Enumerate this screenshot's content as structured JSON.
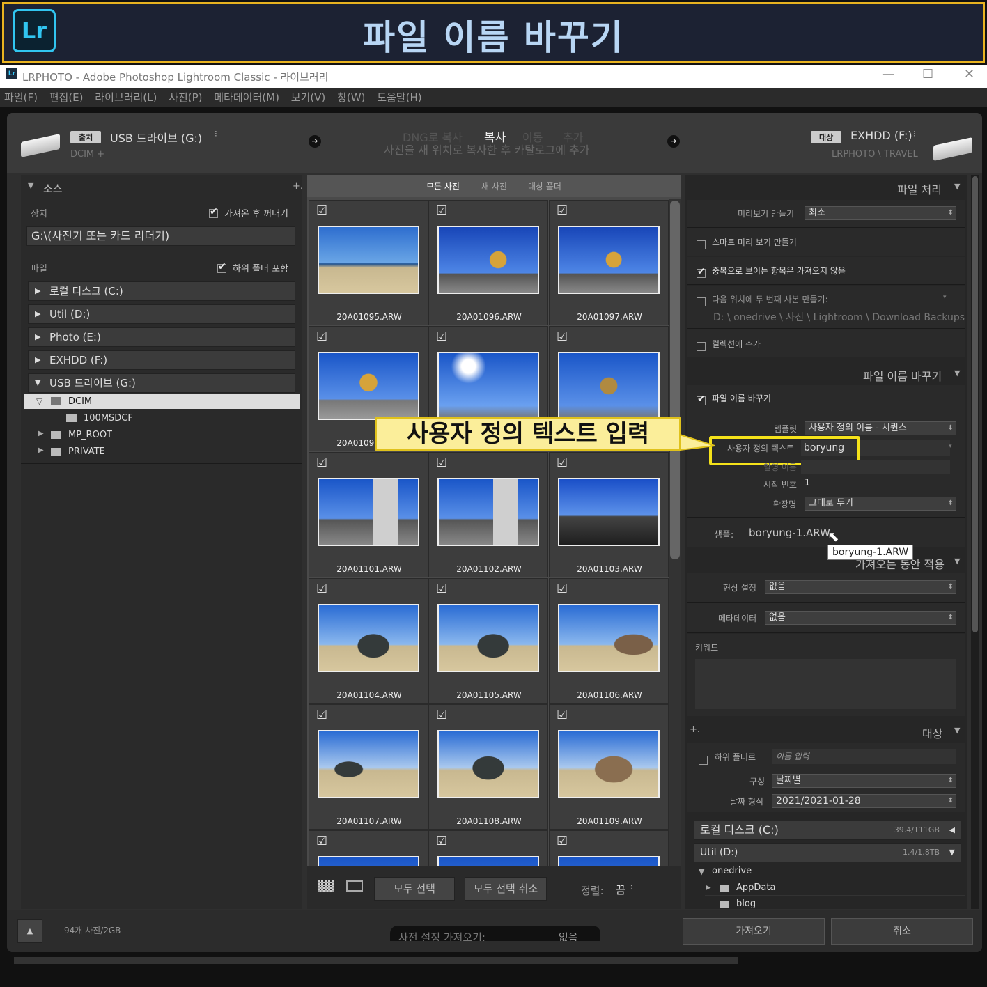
{
  "banner": {
    "logo": "Lr",
    "title": "파일 이름 바꾸기"
  },
  "window": {
    "title": "LRPHOTO - Adobe Photoshop Lightroom Classic - 라이브러리",
    "min": "—",
    "max": "☐",
    "close": "✕"
  },
  "menu": [
    "파일(F)",
    "편집(E)",
    "라이브러리(L)",
    "사진(P)",
    "메타데이터(M)",
    "보기(V)",
    "창(W)",
    "도움말(H)"
  ],
  "source": {
    "tag": "출처",
    "drive": "USB 드라이브 (G:)",
    "path": "DCIM +"
  },
  "modes": {
    "dng": "DNG로 복사",
    "copy": "복사",
    "move": "이동",
    "add": "추가",
    "description": "사진을 새 위치로 복사한 후 카탈로그에 추가"
  },
  "dest": {
    "tag": "대상",
    "drive": "EXHDD (F:)",
    "path": "LRPHOTO \\ TRAVEL"
  },
  "left": {
    "header": "소스",
    "add": "+.",
    "device_label": "장치",
    "eject": "가져온 후 꺼내기",
    "device": "G:\\(사진기 또는 카드 리더기)",
    "files_label": "파일",
    "subfolders": "하위 폴더 포함",
    "drives": [
      "로컬 디스크 (C:)",
      "Util (D:)",
      "Photo (E:)",
      "EXHDD (F:)",
      "USB 드라이브 (G:)"
    ],
    "folders": [
      "DCIM",
      "100MSDCF",
      "MP_ROOT",
      "PRIVATE"
    ]
  },
  "grid": {
    "tabs": [
      "모든 사진",
      "새 사진",
      "대상 폴더"
    ],
    "photos": [
      "20A01095.ARW",
      "20A01096.ARW",
      "20A01097.ARW",
      "20A01098.ARW",
      "",
      "",
      "20A01101.ARW",
      "20A01102.ARW",
      "20A01103.ARW",
      "20A01104.ARW",
      "20A01105.ARW",
      "20A01106.ARW",
      "20A01107.ARW",
      "20A01108.ARW",
      "20A01109.ARW"
    ],
    "select_all": "모두 선택",
    "deselect_all": "모두 선택 취소",
    "sort_label": "정렬:",
    "sort_value": "끔"
  },
  "callout": "사용자 정의 텍스트 입력",
  "right": {
    "file_handling": "파일 처리",
    "preview_label": "미리보기 만들기",
    "preview_value": "최소",
    "smart_preview": "스마트 미리 보기 만들기",
    "no_dup": "중복으로 보이는 항목은 가져오지 않음",
    "second_copy": "다음 위치에 두 번째 사본 만들기:",
    "second_path": "D: \\ onedrive \\ 사진 \\ Lightroom \\ Download Backups",
    "add_collection": "컬렉션에 추가",
    "rename_hdr": "파일 이름 바꾸기",
    "rename_cb": "파일 이름 바꾸기",
    "template_label": "템플릿",
    "template_value": "사용자 정의 이름 - 시퀀스",
    "custom_label": "사용자 정의 텍스트",
    "custom_value": "boryung",
    "shoot_label": "촬영 이름",
    "start_label": "시작 번호",
    "start_value": "1",
    "ext_label": "확장명",
    "ext_value": "그대로 두기",
    "sample_label": "샘플:",
    "sample_value": "boryung-1.ARW",
    "tooltip": "boryung-1.ARW",
    "apply_hdr": "가져오는 동안 적용",
    "develop_label": "현상 설정",
    "develop_value": "없음",
    "meta_label": "메타데이터",
    "meta_value": "없음",
    "keyword_label": "키워드",
    "dest_hdr": "대상",
    "dest_add": "+.",
    "into_sub": "하위 폴더로",
    "into_sub_placeholder": "이름 입력",
    "org_label": "구성",
    "org_value": "날짜별",
    "date_label": "날짜 형식",
    "date_value": "2021/2021-01-28",
    "drive1": "로컬 디스크 (C:)",
    "drive1_size": "39.4/111GB",
    "drive2": "Util (D:)",
    "drive2_size": "1.4/1.8TB",
    "tree": [
      "onedrive",
      "AppData",
      "blog"
    ]
  },
  "bottom": {
    "count": "94개 사진/2GB",
    "preset_label": "사전 설정 가져오기:",
    "preset_value": "없음",
    "import": "가져오기",
    "cancel": "취소"
  }
}
